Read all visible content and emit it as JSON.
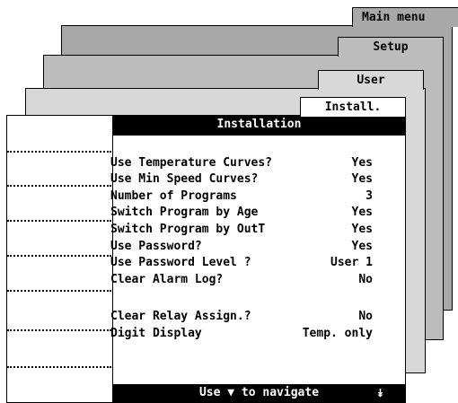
{
  "tabs": {
    "main_menu": "Main menu",
    "setup": "Setup",
    "user": "User",
    "install": "Install."
  },
  "panel": {
    "title": "Installation",
    "footer_text": "Use ▼ to navigate",
    "footer_scroll": "⯯"
  },
  "settings": [
    {
      "label": "Use Temperature Curves?",
      "value": "Yes"
    },
    {
      "label": "Use Min Speed Curves?",
      "value": "Yes"
    },
    {
      "label": "Number of Programs",
      "value": "3"
    },
    {
      "label": "Switch Program by Age",
      "value": "Yes"
    },
    {
      "label": "Switch Program by OutT",
      "value": "Yes"
    },
    {
      "label": "Use Password?",
      "value": "Yes"
    },
    {
      "label": "Use Password Level ?",
      "value": "User 1"
    },
    {
      "label": "Clear Alarm Log?",
      "value": "No"
    },
    {
      "label": "Clear Relay Assign.?",
      "value": "No"
    },
    {
      "label": "Digit Display",
      "value": "Temp. only"
    }
  ],
  "colors": {
    "main_menu_bg": "#a8a8a8",
    "setup_bg": "#bcbcbc",
    "user_bg": "#d8d8d8",
    "install_bg": "#ffffff",
    "titlebar_bg": "#000000"
  }
}
